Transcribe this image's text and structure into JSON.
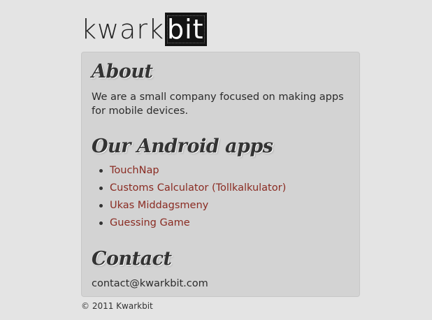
{
  "logo": {
    "part1": "kwark",
    "part2": "bit"
  },
  "about": {
    "heading": "About",
    "text": "We are a small company focused on making apps for mobile devices."
  },
  "apps": {
    "heading": "Our Android apps",
    "items": [
      {
        "label": "TouchNap"
      },
      {
        "label": "Customs Calculator (Tollkalkulator)"
      },
      {
        "label": "Ukas Middagsmeny"
      },
      {
        "label": "Guessing Game"
      }
    ]
  },
  "contact": {
    "heading": "Contact",
    "email": "contact@kwarkbit.com"
  },
  "footer": {
    "copyright": "© 2011 Kwarkbit"
  },
  "colors": {
    "background": "#e4e4e4",
    "card": "#d3d3d3",
    "link": "#8a2b22",
    "logo_block": "#141414"
  }
}
